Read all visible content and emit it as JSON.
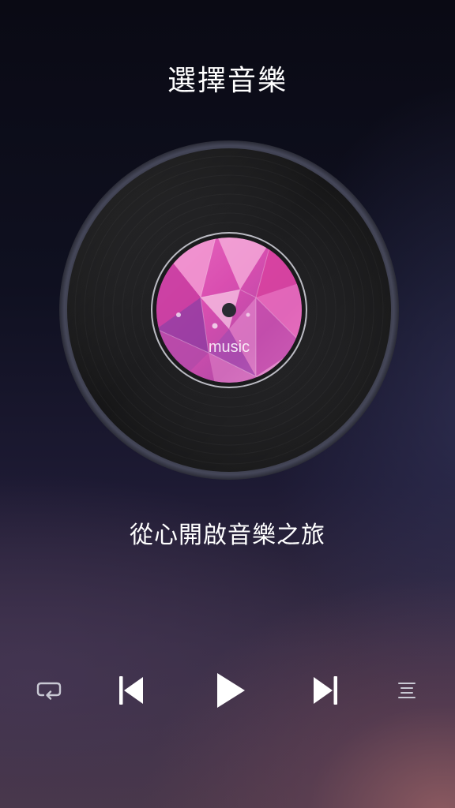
{
  "header": {
    "title": "選擇音樂"
  },
  "record": {
    "label_text": "music"
  },
  "tagline": "從心開啟音樂之旅",
  "controls": {
    "repeat_icon": "repeat-icon",
    "previous_icon": "skip-previous-icon",
    "play_icon": "play-icon",
    "next_icon": "skip-next-icon",
    "playlist_icon": "playlist-icon"
  },
  "colors": {
    "record_rim": "#3a3c4a",
    "record_body": "#1b1b1d",
    "label_pink": "#d84aa8",
    "label_light_pink": "#f49ad0",
    "label_purple": "#8a3aa0",
    "control_white": "#ffffff",
    "control_dim": "#c9c9d4"
  }
}
